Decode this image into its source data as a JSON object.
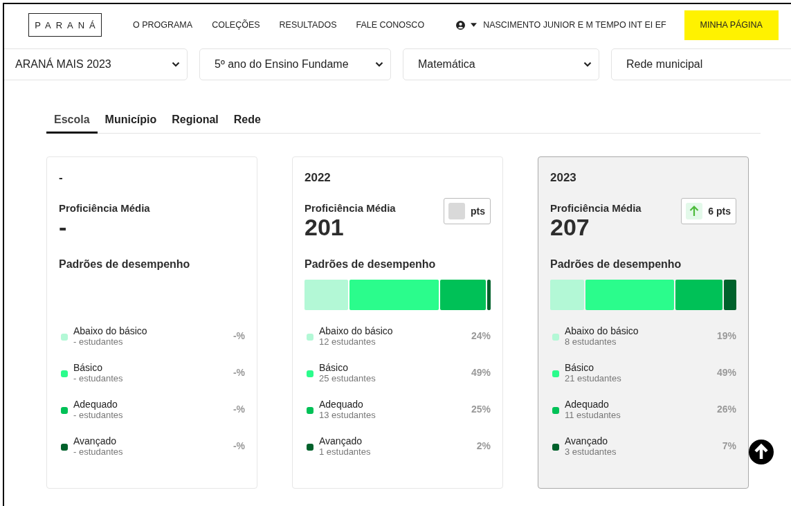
{
  "header": {
    "logo": "PARANÁ",
    "nav": [
      "O PROGRAMA",
      "COLEÇÕES",
      "RESULTADOS",
      "FALE CONOSCO"
    ],
    "user": "NASCIMENTO JUNIOR E M TEMPO INT EI EF",
    "cta": "MINHA PÁGINA"
  },
  "filters": [
    "ARANÁ MAIS 2023",
    "5º ano do Ensino Fundame",
    "Matemática",
    "Rede municipal"
  ],
  "tabs": [
    {
      "label": "Escola",
      "selected": true
    },
    {
      "label": "Município",
      "selected": false
    },
    {
      "label": "Regional",
      "selected": false
    },
    {
      "label": "Rede",
      "selected": false
    }
  ],
  "cards": [
    {
      "year": "-",
      "title": "Proficiência Média",
      "value": "-",
      "selected": false,
      "section": "Padrões de desempenho",
      "bar": false,
      "levels": [
        {
          "name": "Abaixo do básico",
          "students": "- estudantes",
          "percent": "-%",
          "color": "#b3f8d6"
        },
        {
          "name": "Básico",
          "students": "- estudantes",
          "percent": "-%",
          "color": "#2bfc8c"
        },
        {
          "name": "Adequado",
          "students": "- estudantes",
          "percent": "-%",
          "color": "#00c157"
        },
        {
          "name": "Avançado",
          "students": "- estudantes",
          "percent": "-%",
          "color": "#00612b"
        }
      ]
    },
    {
      "year": "2022",
      "title": "Proficiência Média",
      "value": "201",
      "selected": false,
      "delta": {
        "kind": "none",
        "text": "pts"
      },
      "section": "Padrões de desempenho",
      "bar": true,
      "levels": [
        {
          "name": "Abaixo do básico",
          "students": "12 estudantes",
          "percent": "24%",
          "color": "#b3f8d6"
        },
        {
          "name": "Básico",
          "students": "25 estudantes",
          "percent": "49%",
          "color": "#2bfc8c"
        },
        {
          "name": "Adequado",
          "students": "13 estudantes",
          "percent": "25%",
          "color": "#00c157"
        },
        {
          "name": "Avançado",
          "students": "1 estudantes",
          "percent": "2%",
          "color": "#00612b"
        }
      ]
    },
    {
      "year": "2023",
      "title": "Proficiência Média",
      "value": "207",
      "selected": true,
      "delta": {
        "kind": "up",
        "text": "6 pts"
      },
      "section": "Padrões de desempenho",
      "bar": true,
      "levels": [
        {
          "name": "Abaixo do básico",
          "students": "8 estudantes",
          "percent": "19%",
          "color": "#b3f8d6"
        },
        {
          "name": "Básico",
          "students": "21 estudantes",
          "percent": "49%",
          "color": "#2bfc8c"
        },
        {
          "name": "Adequado",
          "students": "11 estudantes",
          "percent": "26%",
          "color": "#00c157"
        },
        {
          "name": "Avançado",
          "students": "3 estudantes",
          "percent": "7%",
          "color": "#00612b"
        }
      ]
    }
  ]
}
